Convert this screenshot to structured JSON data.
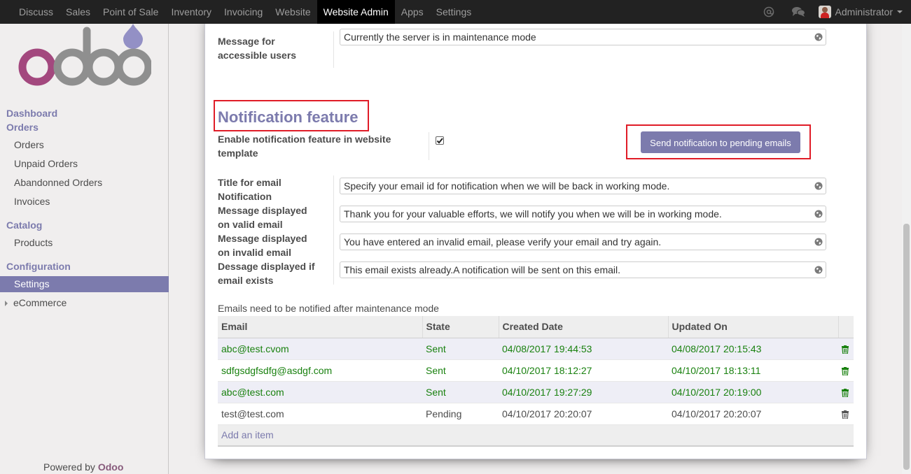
{
  "topbar": {
    "menus": [
      "Discuss",
      "Sales",
      "Point of Sale",
      "Inventory",
      "Invoicing",
      "Website",
      "Website Admin",
      "Apps",
      "Settings"
    ],
    "active_menu": "Website Admin",
    "user": "Administrator",
    "icons": [
      "at-icon",
      "chat-icon"
    ]
  },
  "sidebar": {
    "logo": "odoo",
    "dashboard": "Dashboard",
    "orders_group": "Orders",
    "orders_items": [
      "Orders",
      "Unpaid Orders",
      "Abandonned Orders",
      "Invoices"
    ],
    "catalog_group": "Catalog",
    "catalog_items": [
      "Products"
    ],
    "config_group": "Configuration",
    "settings": "Settings",
    "ecommerce": "eCommerce",
    "powered_prefix": "Powered by ",
    "powered_brand": "Odoo"
  },
  "form": {
    "top_label_line1": "Message for",
    "top_label_line2": "accessible users",
    "top_value": "Currently the server is in maintenance mode",
    "section_title": "Notification feature",
    "enable_label_line1": "Enable notification feature in website",
    "enable_label_line2": "template",
    "enable_checked": true,
    "send_button": "Send notification to pending emails",
    "fields": [
      {
        "label1": "Title for email",
        "label2": "Notification",
        "value": "Specify your email id for notification when we will be back in working mode."
      },
      {
        "label1": "Message displayed",
        "label2": "on valid email",
        "value": "Thank you for your valuable efforts, we will notify you when we will be in working mode."
      },
      {
        "label1": "Message displayed",
        "label2": "on invalid email",
        "value": "You have entered an invalid email, please verify your email and try again."
      },
      {
        "label1": "Dessage displayed if",
        "label2": "email exists",
        "value": "This email exists already.A notification will be sent on this email."
      }
    ]
  },
  "email_list": {
    "caption": "Emails need to be notified after maintenance mode",
    "columns": [
      "Email",
      "State",
      "Created Date",
      "Updated On"
    ],
    "rows": [
      {
        "email": "abc@test.cvom",
        "state": "Sent",
        "created": "04/08/2017 19:44:53",
        "updated": "04/08/2017 20:15:43"
      },
      {
        "email": "sdfgsdgfsdfg@asdgf.com",
        "state": "Sent",
        "created": "04/10/2017 18:12:27",
        "updated": "04/10/2017 18:13:11"
      },
      {
        "email": "abc@test.com",
        "state": "Sent",
        "created": "04/10/2017 19:27:29",
        "updated": "04/10/2017 20:19:00"
      },
      {
        "email": "test@test.com",
        "state": "Pending",
        "created": "04/10/2017 20:20:07",
        "updated": "04/10/2017 20:20:07"
      }
    ],
    "add_item": "Add an item"
  },
  "colors": {
    "accent": "#7c7bad",
    "sent": "#19810f",
    "highlight": "#e01c27",
    "topbar": "#222222"
  }
}
